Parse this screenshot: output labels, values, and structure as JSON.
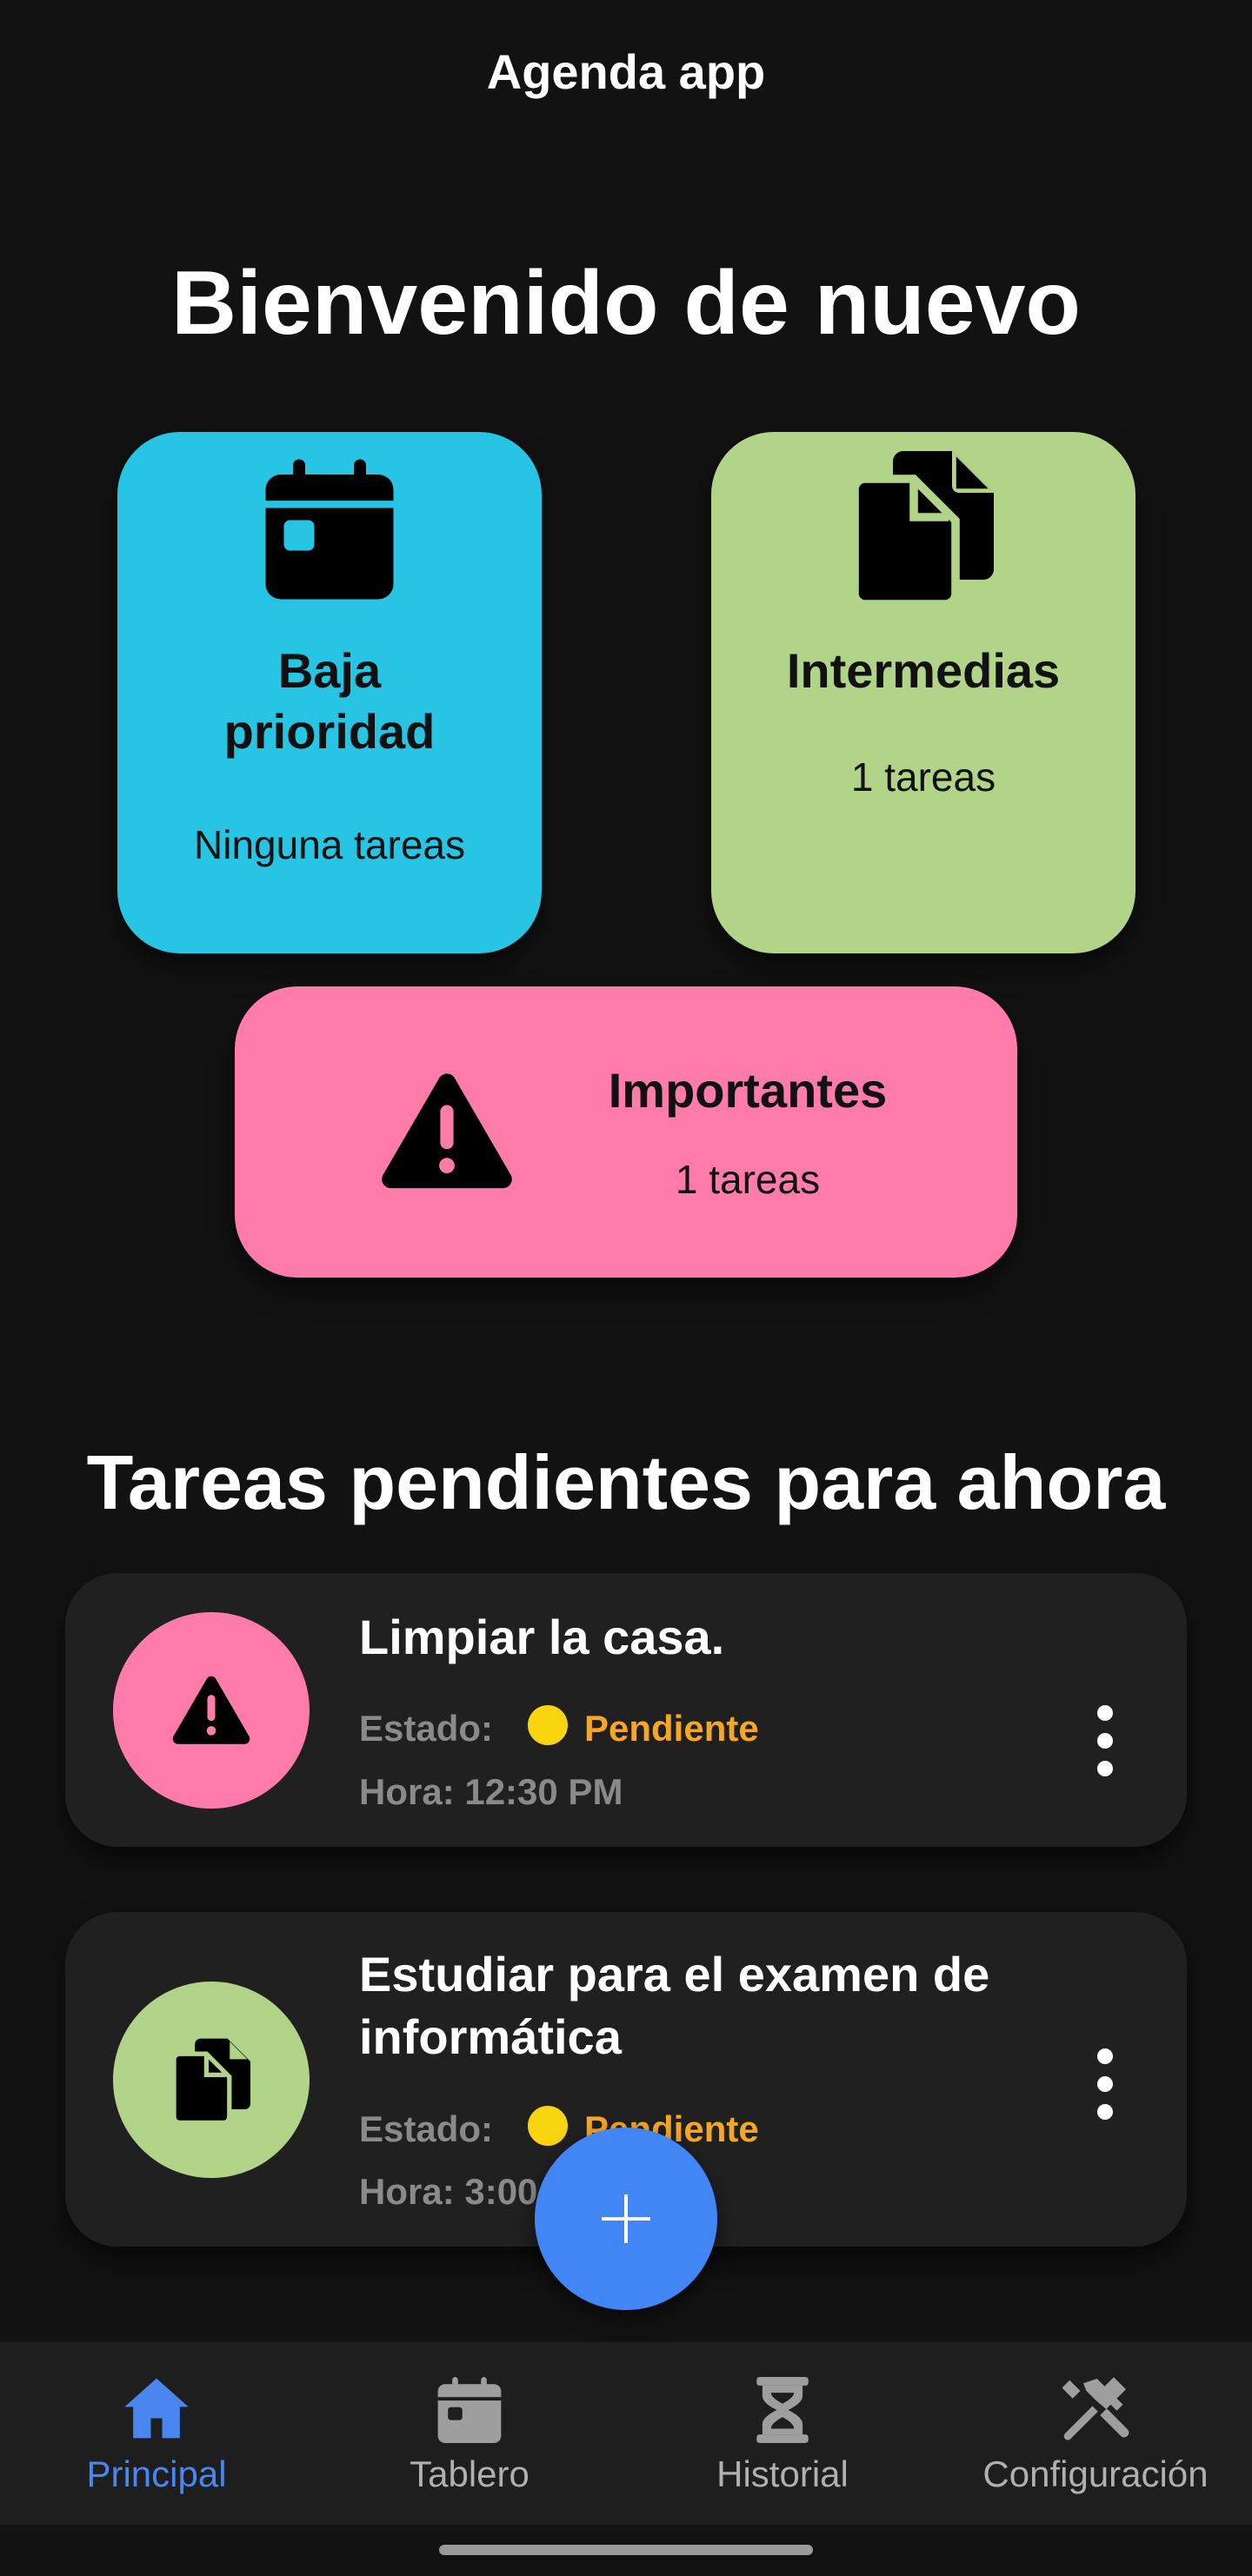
{
  "app": {
    "title": "Agenda app"
  },
  "welcome": "Bienvenido de nuevo",
  "cards": {
    "low": {
      "title_line1": "Baja",
      "title_line2": "prioridad",
      "count": "Ninguna tareas",
      "color": "#28C4E3",
      "icon": "calendar-icon"
    },
    "medium": {
      "title": "Intermedias",
      "count": "1 tareas",
      "color": "#B2D489",
      "icon": "copy-files-icon"
    },
    "important": {
      "title": "Importantes",
      "count": "1 tareas",
      "color": "#FF7BA9",
      "icon": "warning-icon"
    }
  },
  "pending": {
    "title": "Tareas pendientes para ahora",
    "tasks": [
      {
        "title": "Limpiar la casa.",
        "state_label": "Estado:",
        "state": "Pendiente",
        "time": "Hora: 12:30 PM",
        "color": "#FF7BA9",
        "icon": "warning-icon"
      },
      {
        "title_line1": "Estudiar para el examen de",
        "title_line2": "informática",
        "state_label": "Estado:",
        "state": "Pendiente",
        "time": "Hora: 3:00",
        "color": "#B2D489",
        "icon": "copy-files-icon"
      }
    ]
  },
  "fab": {
    "icon": "plus-icon"
  },
  "nav": {
    "items": [
      {
        "label": "Principal",
        "icon": "home-icon",
        "active": true
      },
      {
        "label": "Tablero",
        "icon": "calendar-icon",
        "active": false
      },
      {
        "label": "Historial",
        "icon": "hourglass-icon",
        "active": false
      },
      {
        "label": "Configuración",
        "icon": "tools-icon",
        "active": false
      }
    ]
  },
  "colors": {
    "accent": "#4285F4",
    "status_pending": "#F5A623",
    "status_dot": "#F9D50F"
  }
}
